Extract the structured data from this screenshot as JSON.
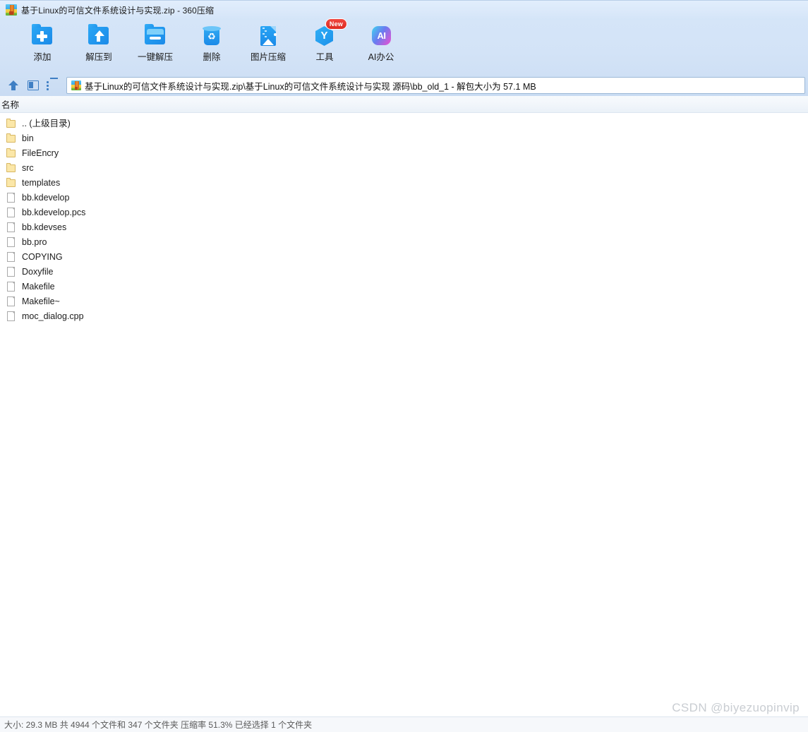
{
  "window": {
    "title": "基于Linux的可信文件系统设计与实现.zip - 360压缩",
    "icon": "zip-file-icon"
  },
  "toolbar": {
    "buttons": [
      {
        "label": "添加",
        "icon": "folder-plus-icon",
        "badge": ""
      },
      {
        "label": "解压到",
        "icon": "folder-extract-to-icon",
        "badge": ""
      },
      {
        "label": "一键解压",
        "icon": "one-click-extract-icon",
        "badge": ""
      },
      {
        "label": "删除",
        "icon": "recycle-bin-icon",
        "badge": ""
      },
      {
        "label": "图片压缩",
        "icon": "image-compress-icon",
        "badge": ""
      },
      {
        "label": "工具",
        "icon": "tools-hexagon-icon",
        "badge": "New"
      },
      {
        "label": "AI办公",
        "icon": "ai-office-icon",
        "badge": ""
      }
    ]
  },
  "addressbar": {
    "nav_icons": [
      "up-arrow-icon",
      "preview-panel-icon",
      "list-view-icon"
    ],
    "path_icon": "zip-file-icon",
    "path": "基于Linux的可信文件系统设计与实现.zip\\基于Linux的可信文件系统设计与实现 源码\\bb_old_1 - 解包大小为 57.1 MB"
  },
  "list": {
    "columns": [
      "名称"
    ],
    "rows": [
      {
        "name": ".. (上级目录)",
        "type": "folder"
      },
      {
        "name": "bin",
        "type": "folder"
      },
      {
        "name": "FileEncry",
        "type": "folder"
      },
      {
        "name": "src",
        "type": "folder"
      },
      {
        "name": "templates",
        "type": "folder"
      },
      {
        "name": "bb.kdevelop",
        "type": "file"
      },
      {
        "name": "bb.kdevelop.pcs",
        "type": "file"
      },
      {
        "name": "bb.kdevses",
        "type": "file"
      },
      {
        "name": "bb.pro",
        "type": "file"
      },
      {
        "name": "COPYING",
        "type": "file"
      },
      {
        "name": "Doxyfile",
        "type": "file"
      },
      {
        "name": "Makefile",
        "type": "file"
      },
      {
        "name": "Makefile~",
        "type": "file"
      },
      {
        "name": "moc_dialog.cpp",
        "type": "file"
      }
    ]
  },
  "statusbar": {
    "text": "大小: 29.3 MB 共 4944 个文件和 347 个文件夹 压缩率 51.3% 已经选择 1 个文件夹"
  },
  "watermark": {
    "text": "CSDN @biyezuopinvip"
  },
  "colors": {
    "titlebar": "#dbe9fa",
    "toolbar": "#d3e3f7",
    "addressbar": "#cbdef4",
    "accent_blue": "#1b8ae8",
    "nav_blue": "#3f7fc4",
    "folder_yellow": "#fbe7a8",
    "badge_red": "#de2b22",
    "status_text": "#5a5a5a",
    "watermark": "#c9cdd2"
  }
}
